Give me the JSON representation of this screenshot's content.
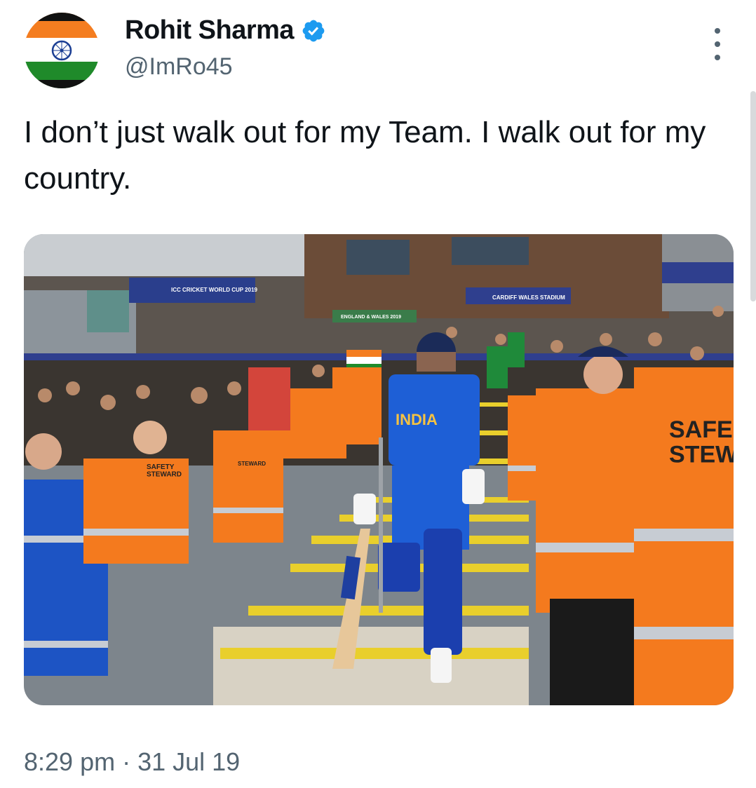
{
  "author": {
    "name": "Rohit Sharma",
    "handle": "@ImRo45",
    "verified": true
  },
  "tweet": {
    "text": "I don’t just walk out for my Team. I walk out for my country."
  },
  "media": {
    "banner_worldcup": "ICC CRICKET WORLD CUP 2019",
    "banner_stadium": "CARDIFF WALES STADIUM",
    "banner_england": "ENGLAND & WALES 2019",
    "jersey_text": "INDIA",
    "steward_vest_left": "SAFETY\nSTEWARD",
    "steward_vest_mid": "STEWARD",
    "steward_vest_right": "SAFE\nSTEW"
  },
  "meta": {
    "timestamp": "8:29 pm · 31 Jul 19"
  },
  "colors": {
    "verified": "#1d9bf0",
    "text_primary": "#0f1419",
    "text_secondary": "#536471",
    "saffron": "#f47d20",
    "green": "#1f8a2a",
    "jersey_blue": "#1e5fd6",
    "hiviz_orange": "#f47a1e"
  }
}
